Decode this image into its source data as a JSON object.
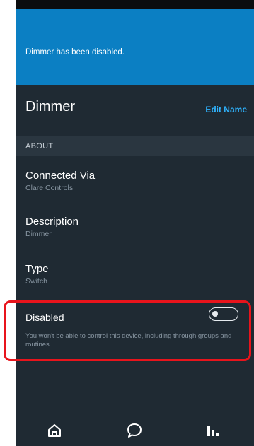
{
  "banner": {
    "message": "Dimmer has been disabled."
  },
  "device": {
    "name": "Dimmer",
    "edit_label": "Edit Name"
  },
  "section": {
    "label": "ABOUT"
  },
  "info": [
    {
      "title": "Connected Via",
      "value": "Clare Controls"
    },
    {
      "title": "Description",
      "value": "Dimmer"
    },
    {
      "title": "Type",
      "value": "Switch"
    }
  ],
  "disabled": {
    "label": "Disabled",
    "description": "You won't be able to control this device, including through groups and routines.",
    "enabled": false
  },
  "nav": {
    "icons": [
      "home-icon",
      "chat-icon",
      "stats-icon"
    ]
  },
  "colors": {
    "banner": "#0b7fc3",
    "background": "#1f2a33",
    "accent_link": "#2fb4ff",
    "highlight": "#e8141c"
  }
}
